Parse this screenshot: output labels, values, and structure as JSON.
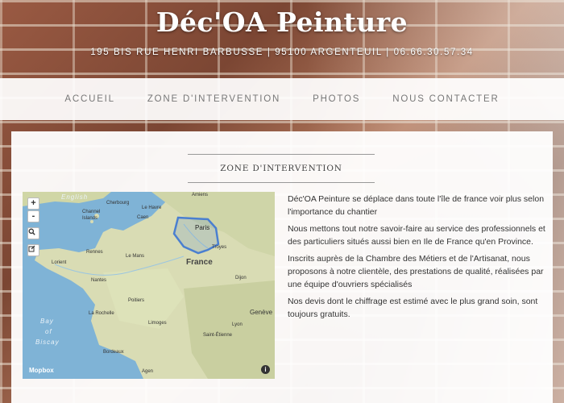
{
  "site": {
    "title": "Déc'OA Peinture",
    "address": "195 BIS RUE HENRI BARBUSSE | 95100 ARGENTEUIL | 06.66.30.57.34"
  },
  "nav": {
    "items": [
      {
        "label": "ACCUEIL"
      },
      {
        "label": "ZONE D'INTERVENTION"
      },
      {
        "label": "PHOTOS"
      },
      {
        "label": "NOUS CONTACTER"
      }
    ]
  },
  "section": {
    "title": "ZONE D'INTERVENTION"
  },
  "map": {
    "zoom_in": "+",
    "zoom_out": "-",
    "attribution": "Mopbox",
    "info": "i",
    "labels": {
      "english": "English",
      "cherbourg": "Cherbourg",
      "le_havre": "Le Havre",
      "amiens": "Amiens",
      "channel_islands": "Channel Islands",
      "caen": "Caen",
      "paris": "Paris",
      "rennes": "Rennes",
      "le_mans": "Le Mans",
      "lorient": "Lorient",
      "france": "France",
      "troyes": "Troyes",
      "nantes": "Nantes",
      "dijon": "Dijon",
      "poitiers": "Poitiers",
      "la_rochelle": "La Rochelle",
      "limoges": "Limoges",
      "geneve": "Genève",
      "lyon": "Lyon",
      "saint_etienne": "Saint-Étienne",
      "bordeaux": "Bordeaux",
      "agen": "Agen",
      "bay1": "Bay",
      "bay2": "of",
      "bay3": "Biscay"
    },
    "zone_color": "#4a7fd0"
  },
  "content": {
    "paragraphs": [
      "Déc'OA Peinture se déplace dans toute l'île de france voir plus selon l'importance du chantier",
      "Nous mettons tout notre savoir-faire au service des professionnels et des particuliers situés aussi bien en Ile de France qu'en Province.",
      "Inscrits auprès de la Chambre des Métiers et de l'Artisanat, nous proposons à notre clientèle, des prestations de qualité, réalisées par une équipe d'ouvriers spécialisés",
      "Nos devis dont le chiffrage est estimé avec le plus grand soin, sont toujours gratuits."
    ]
  }
}
